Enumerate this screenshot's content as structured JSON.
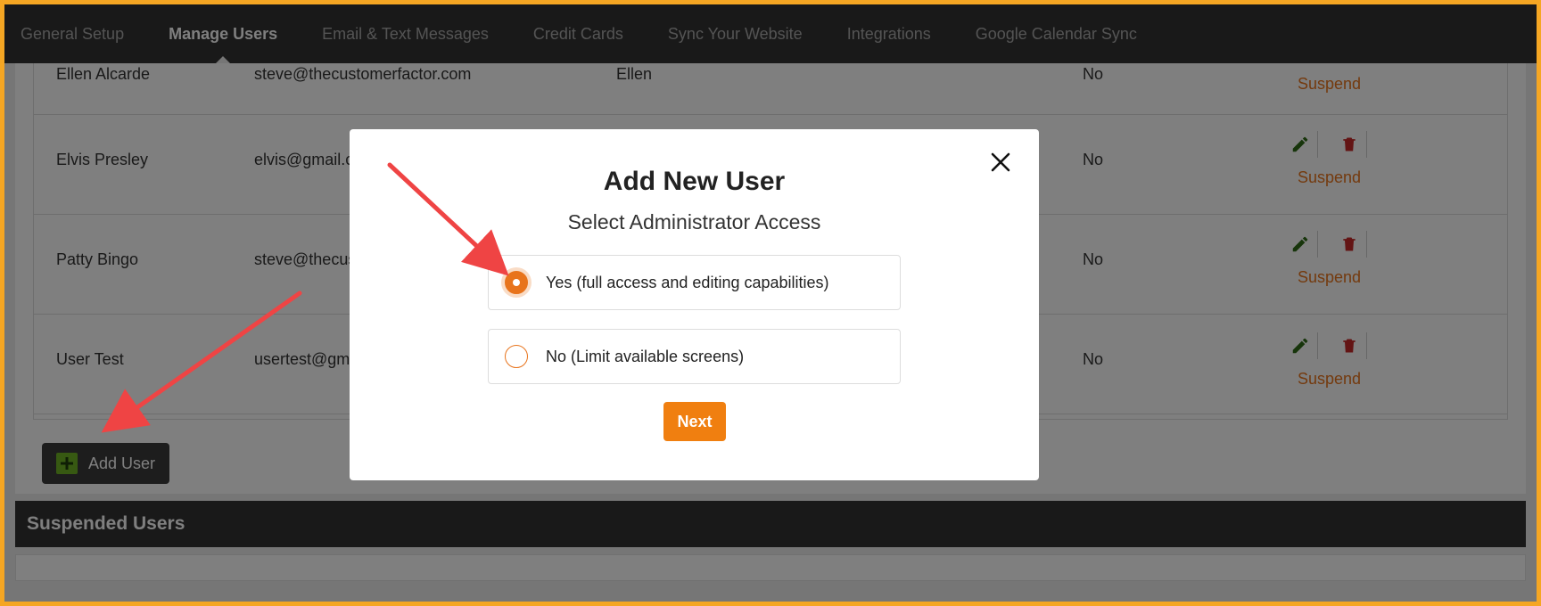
{
  "nav": {
    "tabs": [
      {
        "label": "General Setup",
        "active": false
      },
      {
        "label": "Manage Users",
        "active": true
      },
      {
        "label": "Email & Text Messages",
        "active": false
      },
      {
        "label": "Credit Cards",
        "active": false
      },
      {
        "label": "Sync Your Website",
        "active": false
      },
      {
        "label": "Integrations",
        "active": false
      },
      {
        "label": "Google Calendar Sync",
        "active": false
      }
    ]
  },
  "users": {
    "rows": [
      {
        "name": "Ellen Alcarde",
        "email": "steve@thecustomerfactor.com",
        "nickname": "Ellen",
        "admin": "No",
        "suspend": "Suspend"
      },
      {
        "name": "Elvis Presley",
        "email": "elvis@gmail.c",
        "nickname": "",
        "admin": "No",
        "suspend": "Suspend"
      },
      {
        "name": "Patty Bingo",
        "email": "steve@thecus",
        "nickname": "",
        "admin": "No",
        "suspend": "Suspend"
      },
      {
        "name": "User Test",
        "email": "usertest@gm",
        "nickname": "",
        "admin": "No",
        "suspend": "Suspend"
      }
    ],
    "add_user_label": "Add User"
  },
  "suspended": {
    "title": "Suspended Users"
  },
  "modal": {
    "title": "Add New User",
    "subtitle": "Select Administrator Access",
    "options": [
      {
        "label": "Yes (full access and editing capabilities)",
        "checked": true
      },
      {
        "label": "No (Limit available screens)",
        "checked": false
      }
    ],
    "next_label": "Next"
  },
  "colors": {
    "accent": "#f07f10",
    "nav_bg": "#333333",
    "frame_border": "#f5a623",
    "annotation_arrow": "#ef4444"
  }
}
